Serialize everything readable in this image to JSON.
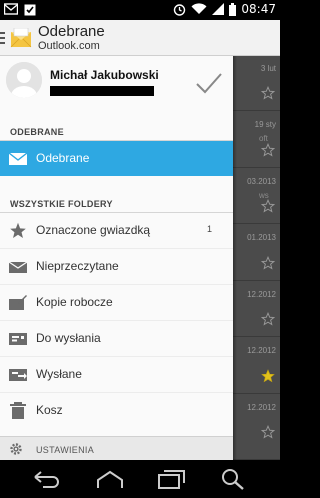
{
  "status_bar": {
    "time": "08:47",
    "icons": [
      "mail-notification-icon",
      "clipboard-check-icon",
      "alarm-icon",
      "wifi-icon",
      "signal-icon",
      "battery-icon"
    ]
  },
  "action_bar": {
    "title": "Odebrane",
    "subtitle": "Outlook.com",
    "menu_icon": "menu-icon",
    "logo_icon": "outlook-envelope-icon"
  },
  "drawer": {
    "account": {
      "name": "Michał Jakubowski",
      "email_redacted": true
    },
    "section_inbox": "ODEBRANE",
    "inbox_item": {
      "label": "Odebrane",
      "icon": "envelope-icon",
      "active": true
    },
    "section_folders": "WSZYSTKIE FOLDERY",
    "folders": [
      {
        "label": "Oznaczone gwiazdką",
        "count": "1",
        "icon": "star-icon"
      },
      {
        "label": "Nieprzeczytane",
        "count": "",
        "icon": "unread-mail-icon"
      },
      {
        "label": "Kopie robocze",
        "count": "",
        "icon": "draft-icon"
      },
      {
        "label": "Do wysłania",
        "count": "",
        "icon": "outbox-icon"
      },
      {
        "label": "Wysłane",
        "count": "",
        "icon": "sent-icon"
      },
      {
        "label": "Kosz",
        "count": "",
        "icon": "trash-icon"
      }
    ],
    "settings_label": "USTAWIENIA"
  },
  "background_list": {
    "rows": [
      {
        "date": "3 lut",
        "snippet": "",
        "starred": false
      },
      {
        "date": "19 sty",
        "snippet": "oft",
        "starred": false
      },
      {
        "date": "03.2013",
        "snippet": "ws",
        "starred": false
      },
      {
        "date": "01.2013",
        "snippet": "",
        "starred": false
      },
      {
        "date": "12.2012",
        "snippet": "",
        "starred": false
      },
      {
        "date": "12.2012",
        "snippet": "",
        "starred": true
      },
      {
        "date": "12.2012",
        "snippet": "",
        "starred": false
      }
    ],
    "star_color": "#e2c21c"
  },
  "nav_bar": {
    "buttons": [
      "back-icon",
      "home-icon",
      "recents-icon",
      "search-icon"
    ]
  },
  "colors": {
    "accent": "#2ea8e2",
    "drawer_bg": "#fafafa",
    "list_bg": "#4b4b4b"
  }
}
